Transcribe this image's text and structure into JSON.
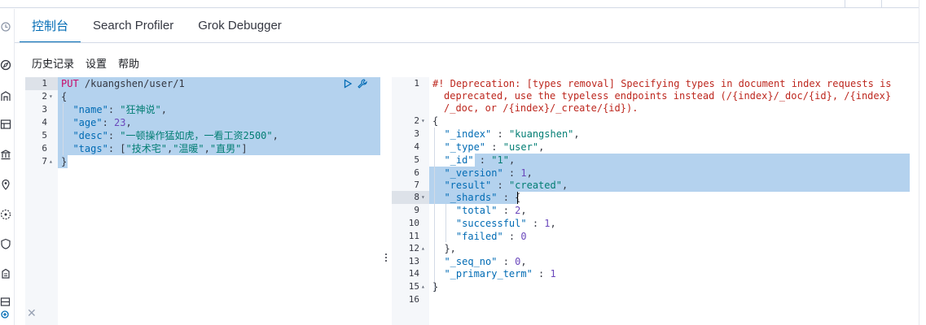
{
  "tabs": [
    {
      "label": "控制台",
      "active": true
    },
    {
      "label": "Search Profiler",
      "active": false
    },
    {
      "label": "Grok Debugger",
      "active": false
    }
  ],
  "menu": {
    "history": "历史记录",
    "settings": "设置",
    "help": "帮助"
  },
  "left_nav_icons": [
    "clock-icon",
    "compass-icon",
    "building-icon",
    "dashboard-icon",
    "bank-icon",
    "map-pin-icon",
    "cluster-icon",
    "shield-icon",
    "security-icon",
    "grid-icon",
    "dock-icon"
  ],
  "request": {
    "line_numbers": [
      "1",
      "2",
      "3",
      "4",
      "5",
      "6",
      "7"
    ],
    "method": "PUT",
    "url": " /kuangshen/user/1",
    "lines": {
      "l2": "{",
      "l3_key": "\"name\"",
      "l3_val": "\"狂神说\"",
      "l4_key": "\"age\"",
      "l4_val": "23",
      "l5_key": "\"desc\"",
      "l5_val": "\"一顿操作猛如虎，一看工资2500\"",
      "l6_key": "\"tags\"",
      "l6_v1": "\"技术宅\"",
      "l6_v2": "\"温暖\"",
      "l6_v3": "\"直男\"",
      "l7": "}"
    }
  },
  "response": {
    "line_numbers": [
      "1",
      "",
      "",
      "2",
      "3",
      "4",
      "5",
      "6",
      "7",
      "8",
      "9",
      "10",
      "11",
      "12",
      "13",
      "14",
      "15",
      "16"
    ],
    "warning": [
      "#! Deprecation: [types removal] Specifying types in document index requests is",
      "deprecated, use the typeless endpoints instead (/{index}/_doc/{id}, /{index}",
      "/_doc, or /{index}/_create/{id})."
    ],
    "lines": {
      "open": "{",
      "index_key": "\"_index\"",
      "index_val": "\"kuangshen\"",
      "type_key": "\"_type\"",
      "type_val": "\"user\"",
      "id_key": "\"_id\"",
      "id_val": "\"1\"",
      "version_key": "\"_version\"",
      "version_val": "1",
      "result_key": "\"result\"",
      "result_val": "\"created\"",
      "shards_key": "\"_shards\"",
      "total_key": "\"total\"",
      "total_val": "2",
      "successful_key": "\"successful\"",
      "successful_val": "1",
      "failed_key": "\"failed\"",
      "failed_val": "0",
      "shards_close": "},",
      "seq_key": "\"_seq_no\"",
      "seq_val": "0",
      "term_key": "\"_primary_term\"",
      "term_val": "1",
      "close": "}"
    }
  },
  "colors": {
    "accent": "#006bb4",
    "selection": "#b4d2ee",
    "method": "#c80a68",
    "warning": "#bd271e"
  }
}
